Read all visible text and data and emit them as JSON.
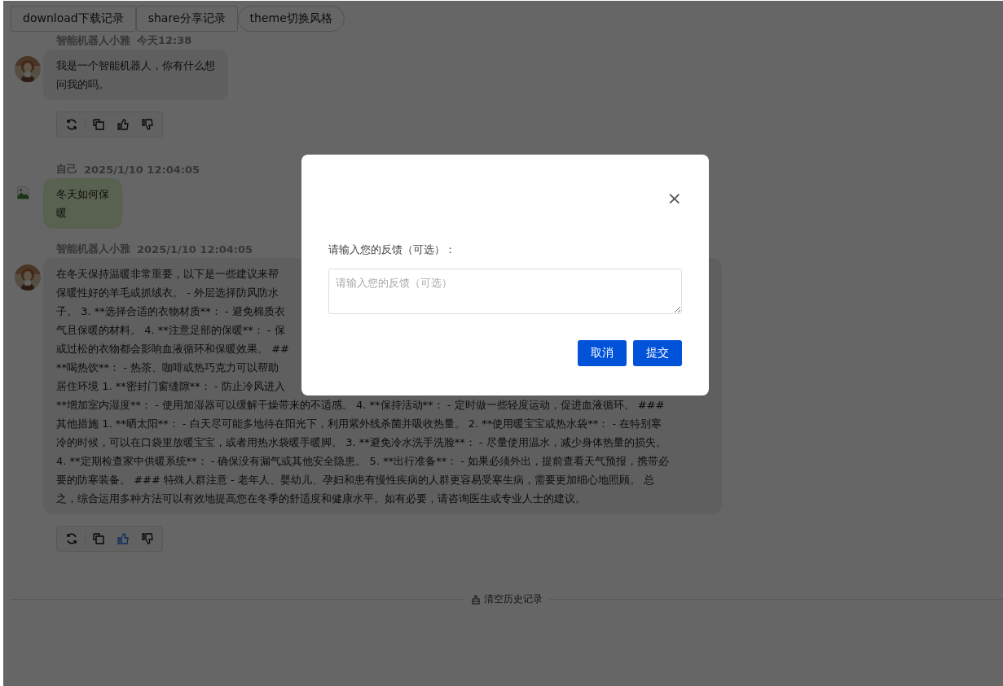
{
  "toolbar_buttons": [
    "download下载记录",
    "share分享记录",
    "theme切换风格"
  ],
  "messages": [
    {
      "kind": "bot",
      "sender": "智能机器人小雅",
      "time": "今天12:38",
      "lines": [
        "我是一个智能机器人，你有什么想",
        "问我的吗。"
      ],
      "actions": {
        "liked": false,
        "disliked": false
      }
    },
    {
      "kind": "user",
      "sender": "自己",
      "time": "2025/1/10 12:04:05",
      "lines": [
        "冬天如何保",
        "暖"
      ]
    },
    {
      "kind": "bot",
      "sender": "智能机器人小雅",
      "time": "2025/1/10 12:04:05",
      "lines": [
        "在冬天保持温暖非常重要，以下是一些建议来帮",
        "保暖性好的羊毛或抓绒衣。 - 外层选择防风防水",
        "子。 3. **选择合适的衣物材质**：  - 避免棉质衣",
        "气且保暖的材料。 4. **注意足部的保暖**：  - 保",
        "或过松的衣物都会影响血液循环和保暖效果。 ##",
        "**喝热饮**：  - 热茶、咖啡或热巧克力可以帮助",
        "居住环境 1. **密封门窗缝隙**：  - 防止冷风进入",
        "**增加室内湿度**：  - 使用加湿器可以缓解干燥带来的不适感。 4. **保持活动**：  - 定时做一些轻度运动，促进血液循环。 ###",
        "其他措施 1. **晒太阳**：  - 白天尽可能多地待在阳光下，利用紫外线杀菌并吸收热量。 2. **使用暖宝宝或热水袋**：  - 在特别寒",
        "冷的时候，可以在口袋里放暖宝宝，或者用热水袋暖手暖脚。 3. **避免冷水洗手洗脸**：  - 尽量使用温水，减少身体热量的损失。",
        "4. **定期检查家中供暖系统**：  - 确保没有漏气或其他安全隐患。 5. **出行准备**：  - 如果必须外出，提前查看天气预报，携带必",
        "要的防寒装备。 ### 特殊人群注意 - 老年人、婴幼儿、孕妇和患有慢性疾病的人群更容易受寒生病，需要更加细心地照顾。 总",
        "之，综合运用多种方法可以有效地提高您在冬季的舒适度和健康水平。如有必要，请咨询医生或专业人士的建议。"
      ],
      "actions": {
        "liked": true,
        "disliked": false
      }
    }
  ],
  "clear_history": "清空历史记录",
  "dialog": {
    "close": "×",
    "label": "请输入您的反馈（可选）：",
    "placeholder": "请输入您的反馈（可选）",
    "buttons": [
      "取消",
      "提交"
    ]
  }
}
